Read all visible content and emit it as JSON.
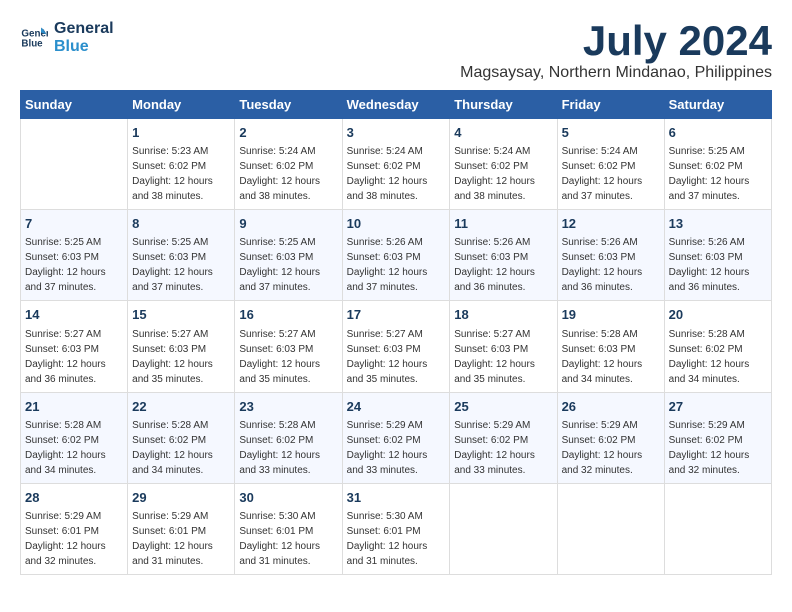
{
  "logo": {
    "line1": "General",
    "line2": "Blue"
  },
  "title": "July 2024",
  "subtitle": "Magsaysay, Northern Mindanao, Philippines",
  "weekdays": [
    "Sunday",
    "Monday",
    "Tuesday",
    "Wednesday",
    "Thursday",
    "Friday",
    "Saturday"
  ],
  "weeks": [
    [
      {
        "day": "",
        "info": ""
      },
      {
        "day": "1",
        "info": "Sunrise: 5:23 AM\nSunset: 6:02 PM\nDaylight: 12 hours\nand 38 minutes."
      },
      {
        "day": "2",
        "info": "Sunrise: 5:24 AM\nSunset: 6:02 PM\nDaylight: 12 hours\nand 38 minutes."
      },
      {
        "day": "3",
        "info": "Sunrise: 5:24 AM\nSunset: 6:02 PM\nDaylight: 12 hours\nand 38 minutes."
      },
      {
        "day": "4",
        "info": "Sunrise: 5:24 AM\nSunset: 6:02 PM\nDaylight: 12 hours\nand 38 minutes."
      },
      {
        "day": "5",
        "info": "Sunrise: 5:24 AM\nSunset: 6:02 PM\nDaylight: 12 hours\nand 37 minutes."
      },
      {
        "day": "6",
        "info": "Sunrise: 5:25 AM\nSunset: 6:02 PM\nDaylight: 12 hours\nand 37 minutes."
      }
    ],
    [
      {
        "day": "7",
        "info": "Sunrise: 5:25 AM\nSunset: 6:03 PM\nDaylight: 12 hours\nand 37 minutes."
      },
      {
        "day": "8",
        "info": "Sunrise: 5:25 AM\nSunset: 6:03 PM\nDaylight: 12 hours\nand 37 minutes."
      },
      {
        "day": "9",
        "info": "Sunrise: 5:25 AM\nSunset: 6:03 PM\nDaylight: 12 hours\nand 37 minutes."
      },
      {
        "day": "10",
        "info": "Sunrise: 5:26 AM\nSunset: 6:03 PM\nDaylight: 12 hours\nand 37 minutes."
      },
      {
        "day": "11",
        "info": "Sunrise: 5:26 AM\nSunset: 6:03 PM\nDaylight: 12 hours\nand 36 minutes."
      },
      {
        "day": "12",
        "info": "Sunrise: 5:26 AM\nSunset: 6:03 PM\nDaylight: 12 hours\nand 36 minutes."
      },
      {
        "day": "13",
        "info": "Sunrise: 5:26 AM\nSunset: 6:03 PM\nDaylight: 12 hours\nand 36 minutes."
      }
    ],
    [
      {
        "day": "14",
        "info": "Sunrise: 5:27 AM\nSunset: 6:03 PM\nDaylight: 12 hours\nand 36 minutes."
      },
      {
        "day": "15",
        "info": "Sunrise: 5:27 AM\nSunset: 6:03 PM\nDaylight: 12 hours\nand 35 minutes."
      },
      {
        "day": "16",
        "info": "Sunrise: 5:27 AM\nSunset: 6:03 PM\nDaylight: 12 hours\nand 35 minutes."
      },
      {
        "day": "17",
        "info": "Sunrise: 5:27 AM\nSunset: 6:03 PM\nDaylight: 12 hours\nand 35 minutes."
      },
      {
        "day": "18",
        "info": "Sunrise: 5:27 AM\nSunset: 6:03 PM\nDaylight: 12 hours\nand 35 minutes."
      },
      {
        "day": "19",
        "info": "Sunrise: 5:28 AM\nSunset: 6:03 PM\nDaylight: 12 hours\nand 34 minutes."
      },
      {
        "day": "20",
        "info": "Sunrise: 5:28 AM\nSunset: 6:02 PM\nDaylight: 12 hours\nand 34 minutes."
      }
    ],
    [
      {
        "day": "21",
        "info": "Sunrise: 5:28 AM\nSunset: 6:02 PM\nDaylight: 12 hours\nand 34 minutes."
      },
      {
        "day": "22",
        "info": "Sunrise: 5:28 AM\nSunset: 6:02 PM\nDaylight: 12 hours\nand 34 minutes."
      },
      {
        "day": "23",
        "info": "Sunrise: 5:28 AM\nSunset: 6:02 PM\nDaylight: 12 hours\nand 33 minutes."
      },
      {
        "day": "24",
        "info": "Sunrise: 5:29 AM\nSunset: 6:02 PM\nDaylight: 12 hours\nand 33 minutes."
      },
      {
        "day": "25",
        "info": "Sunrise: 5:29 AM\nSunset: 6:02 PM\nDaylight: 12 hours\nand 33 minutes."
      },
      {
        "day": "26",
        "info": "Sunrise: 5:29 AM\nSunset: 6:02 PM\nDaylight: 12 hours\nand 32 minutes."
      },
      {
        "day": "27",
        "info": "Sunrise: 5:29 AM\nSunset: 6:02 PM\nDaylight: 12 hours\nand 32 minutes."
      }
    ],
    [
      {
        "day": "28",
        "info": "Sunrise: 5:29 AM\nSunset: 6:01 PM\nDaylight: 12 hours\nand 32 minutes."
      },
      {
        "day": "29",
        "info": "Sunrise: 5:29 AM\nSunset: 6:01 PM\nDaylight: 12 hours\nand 31 minutes."
      },
      {
        "day": "30",
        "info": "Sunrise: 5:30 AM\nSunset: 6:01 PM\nDaylight: 12 hours\nand 31 minutes."
      },
      {
        "day": "31",
        "info": "Sunrise: 5:30 AM\nSunset: 6:01 PM\nDaylight: 12 hours\nand 31 minutes."
      },
      {
        "day": "",
        "info": ""
      },
      {
        "day": "",
        "info": ""
      },
      {
        "day": "",
        "info": ""
      }
    ]
  ]
}
